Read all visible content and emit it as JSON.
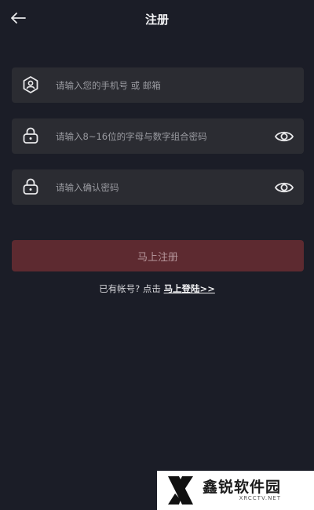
{
  "header": {
    "title": "注册",
    "back_icon": "arrow-left-icon"
  },
  "form": {
    "account_field": {
      "placeholder": "请输入您的手机号 或 邮箱",
      "value": "",
      "icon": "user-shield-icon"
    },
    "password_field": {
      "placeholder": "请输入8~16位的字母与数字组合密码",
      "value": "",
      "icon": "lock-icon",
      "toggle_icon": "eye-icon"
    },
    "confirm_field": {
      "placeholder": "请输入确认密码",
      "value": "",
      "icon": "lock-icon",
      "toggle_icon": "eye-icon"
    },
    "submit_label": "马上注册"
  },
  "login_prompt": {
    "text": "已有帐号? 点击 ",
    "link": "马上登陆>>"
  },
  "watermark": {
    "name": "鑫锐软件园",
    "domain": "XRCCTV.NET"
  },
  "colors": {
    "background": "#1b1d27",
    "field_bg": "#2b2c32",
    "button_bg": "#5d2a30",
    "button_text": "#b5959a"
  }
}
